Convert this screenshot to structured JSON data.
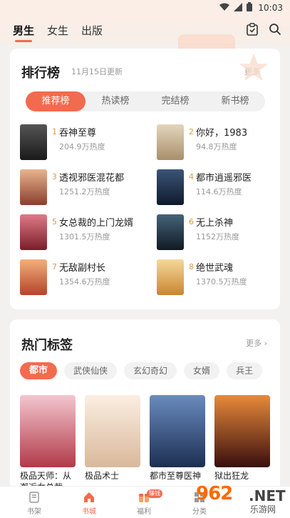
{
  "status": {
    "time": "10:03"
  },
  "header": {
    "tabs": [
      {
        "label": "男生",
        "active": true
      },
      {
        "label": "女生",
        "active": false
      },
      {
        "label": "出版",
        "active": false
      }
    ]
  },
  "ranking": {
    "title": "排行榜",
    "updated": "11月15日更新",
    "more": "更多",
    "segments": [
      {
        "label": "推荐榜",
        "active": true
      },
      {
        "label": "热读榜",
        "active": false
      },
      {
        "label": "完结榜",
        "active": false
      },
      {
        "label": "新书榜",
        "active": false
      }
    ],
    "items": [
      {
        "rank": "1",
        "name": "吞神至尊",
        "heat": "204.9万热度",
        "cover": "#2a2a2a"
      },
      {
        "rank": "2",
        "name": "你好，1983",
        "heat": "94.8万热度",
        "cover": "#c9b99a"
      },
      {
        "rank": "3",
        "name": "透视邪医混花都",
        "heat": "1251.2万热度",
        "cover": "#c0735a"
      },
      {
        "rank": "4",
        "name": "都市逍遥邪医",
        "heat": "114.6万热度",
        "cover": "#1e2b45"
      },
      {
        "rank": "5",
        "name": "女总裁的上门龙婿",
        "heat": "1301.5万热度",
        "cover": "#b23a48"
      },
      {
        "rank": "6",
        "name": "无上杀神",
        "heat": "1152万热度",
        "cover": "#22323f"
      },
      {
        "rank": "7",
        "name": "无敌副村长",
        "heat": "1354.6万热度",
        "cover": "#cf6b3a"
      },
      {
        "rank": "8",
        "name": "绝世武魂",
        "heat": "1370.5万热度",
        "cover": "#e6b36a"
      }
    ]
  },
  "tags": {
    "title": "热门标签",
    "more": "更多",
    "chips": [
      {
        "label": "都市",
        "active": true
      },
      {
        "label": "武侠仙侠",
        "active": false
      },
      {
        "label": "玄幻奇幻",
        "active": false
      },
      {
        "label": "女婿",
        "active": false
      },
      {
        "label": "兵王",
        "active": false
      }
    ],
    "books": [
      {
        "name": "极品天师：从邂逅女总裁",
        "cover": "#c85a6a"
      },
      {
        "name": "极品术士",
        "cover": "#e8d7c2"
      },
      {
        "name": "都市至尊医神",
        "cover": "#2b4a7a"
      },
      {
        "name": "狱出狂龙",
        "cover": "#5a1a1a"
      }
    ]
  },
  "bottomnav": {
    "items": [
      {
        "label": "书架",
        "active": false
      },
      {
        "label": "书城",
        "active": true
      },
      {
        "label": "福利",
        "active": false,
        "badge": "赚钱"
      },
      {
        "label": "分类",
        "active": false
      }
    ]
  },
  "watermark": {
    "logo": "962",
    "net": ".NET",
    "cn": "乐游网"
  },
  "colors": {
    "accent": "#f26b4f",
    "rank_num": "#d89b4b"
  }
}
